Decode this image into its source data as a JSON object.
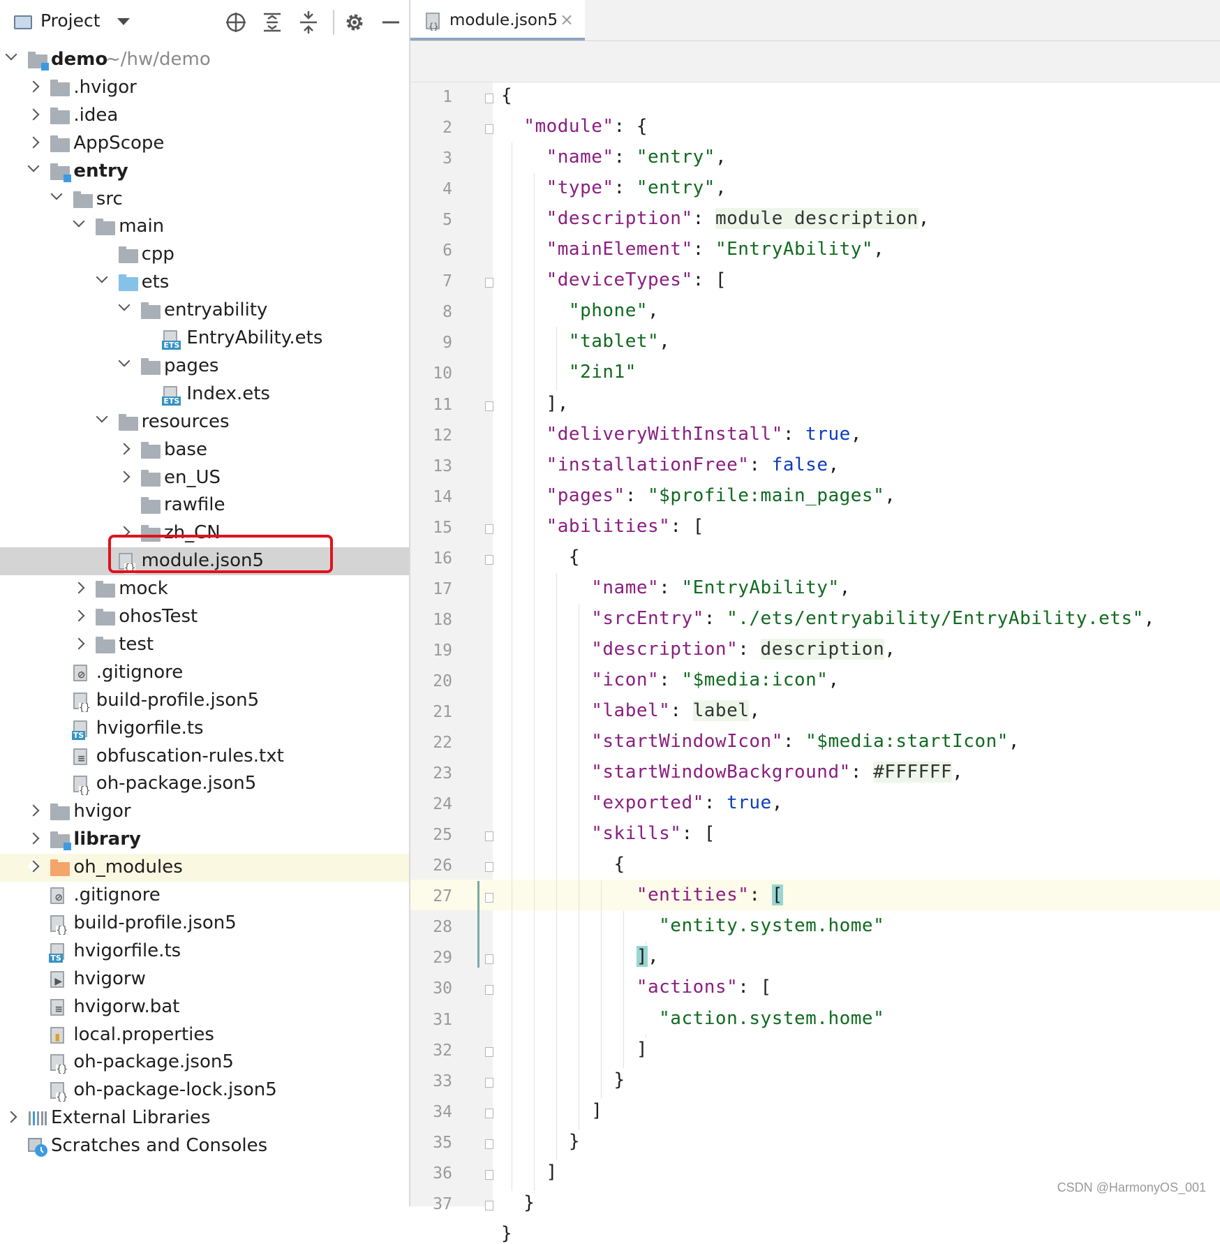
{
  "project_panel": {
    "title": "Project",
    "toolbar_icons": [
      "locate-icon",
      "expand-all-icon",
      "collapse-all-icon",
      "gear-icon",
      "minimize-icon"
    ],
    "tree": [
      {
        "label": "demo",
        "path": "~/hw/demo",
        "depth": 0,
        "arrow": "down",
        "icon": "module-folder",
        "bold": true
      },
      {
        "label": ".hvigor",
        "depth": 1,
        "arrow": "right",
        "icon": "folder"
      },
      {
        "label": ".idea",
        "depth": 1,
        "arrow": "right",
        "icon": "folder"
      },
      {
        "label": "AppScope",
        "depth": 1,
        "arrow": "right",
        "icon": "folder"
      },
      {
        "label": "entry",
        "depth": 1,
        "arrow": "down",
        "icon": "module-folder",
        "bold": true
      },
      {
        "label": "src",
        "depth": 2,
        "arrow": "down",
        "icon": "folder"
      },
      {
        "label": "main",
        "depth": 3,
        "arrow": "down",
        "icon": "folder"
      },
      {
        "label": "cpp",
        "depth": 4,
        "arrow": "none",
        "icon": "folder"
      },
      {
        "label": "ets",
        "depth": 4,
        "arrow": "down",
        "icon": "blue-folder"
      },
      {
        "label": "entryability",
        "depth": 5,
        "arrow": "down",
        "icon": "folder"
      },
      {
        "label": "EntryAbility.ets",
        "depth": 6,
        "arrow": "none",
        "icon": "ets-file"
      },
      {
        "label": "pages",
        "depth": 5,
        "arrow": "down",
        "icon": "folder"
      },
      {
        "label": "Index.ets",
        "depth": 6,
        "arrow": "none",
        "icon": "ets-file"
      },
      {
        "label": "resources",
        "depth": 4,
        "arrow": "down",
        "icon": "folder"
      },
      {
        "label": "base",
        "depth": 5,
        "arrow": "right",
        "icon": "folder"
      },
      {
        "label": "en_US",
        "depth": 5,
        "arrow": "right",
        "icon": "folder"
      },
      {
        "label": "rawfile",
        "depth": 5,
        "arrow": "none",
        "icon": "folder"
      },
      {
        "label": "zh_CN",
        "depth": 5,
        "arrow": "right",
        "icon": "folder"
      },
      {
        "label": "module.json5",
        "depth": 4,
        "arrow": "none",
        "icon": "json-file",
        "selected": true
      },
      {
        "label": "mock",
        "depth": 3,
        "arrow": "right",
        "icon": "folder"
      },
      {
        "label": "ohosTest",
        "depth": 3,
        "arrow": "right",
        "icon": "folder"
      },
      {
        "label": "test",
        "depth": 3,
        "arrow": "right",
        "icon": "folder"
      },
      {
        "label": ".gitignore",
        "depth": 2,
        "arrow": "none",
        "icon": "ignore-file"
      },
      {
        "label": "build-profile.json5",
        "depth": 2,
        "arrow": "none",
        "icon": "json-file"
      },
      {
        "label": "hvigorfile.ts",
        "depth": 2,
        "arrow": "none",
        "icon": "ts-file"
      },
      {
        "label": "obfuscation-rules.txt",
        "depth": 2,
        "arrow": "none",
        "icon": "text-file"
      },
      {
        "label": "oh-package.json5",
        "depth": 2,
        "arrow": "none",
        "icon": "json-file"
      },
      {
        "label": "hvigor",
        "depth": 1,
        "arrow": "right",
        "icon": "folder"
      },
      {
        "label": "library",
        "depth": 1,
        "arrow": "right",
        "icon": "module-folder",
        "bold": true
      },
      {
        "label": "oh_modules",
        "depth": 1,
        "arrow": "right",
        "icon": "orange-folder",
        "highlight": true
      },
      {
        "label": ".gitignore",
        "depth": 1,
        "arrow": "none",
        "icon": "ignore-file"
      },
      {
        "label": "build-profile.json5",
        "depth": 1,
        "arrow": "none",
        "icon": "json-file"
      },
      {
        "label": "hvigorfile.ts",
        "depth": 1,
        "arrow": "none",
        "icon": "ts-file"
      },
      {
        "label": "hvigorw",
        "depth": 1,
        "arrow": "none",
        "icon": "exec-file"
      },
      {
        "label": "hvigorw.bat",
        "depth": 1,
        "arrow": "none",
        "icon": "text-file"
      },
      {
        "label": "local.properties",
        "depth": 1,
        "arrow": "none",
        "icon": "properties-file"
      },
      {
        "label": "oh-package.json5",
        "depth": 1,
        "arrow": "none",
        "icon": "json-file"
      },
      {
        "label": "oh-package-lock.json5",
        "depth": 1,
        "arrow": "none",
        "icon": "json-file"
      },
      {
        "label": "External Libraries",
        "depth": 0,
        "arrow": "right",
        "icon": "libraries-icon"
      },
      {
        "label": "Scratches and Consoles",
        "depth": 0,
        "arrow": "none",
        "icon": "scratches-icon"
      }
    ]
  },
  "editor": {
    "tab": {
      "label": "module.json5",
      "close": "×",
      "icon": "json-file-icon"
    },
    "lines": [
      [
        [
          "p",
          "{"
        ]
      ],
      [
        [
          "p",
          "  "
        ],
        [
          "k",
          "\"module\""
        ],
        [
          "p",
          ": {"
        ]
      ],
      [
        [
          "p",
          "    "
        ],
        [
          "k",
          "\"name\""
        ],
        [
          "p",
          ": "
        ],
        [
          "s",
          "\"entry\""
        ],
        [
          "p",
          ","
        ]
      ],
      [
        [
          "p",
          "    "
        ],
        [
          "k",
          "\"type\""
        ],
        [
          "p",
          ": "
        ],
        [
          "s",
          "\"entry\""
        ],
        [
          "p",
          ","
        ]
      ],
      [
        [
          "p",
          "    "
        ],
        [
          "k",
          "\"description\""
        ],
        [
          "p",
          ": "
        ],
        [
          "n",
          "module description"
        ],
        [
          "p",
          ","
        ]
      ],
      [
        [
          "p",
          "    "
        ],
        [
          "k",
          "\"mainElement\""
        ],
        [
          "p",
          ": "
        ],
        [
          "s",
          "\"EntryAbility\""
        ],
        [
          "p",
          ","
        ]
      ],
      [
        [
          "p",
          "    "
        ],
        [
          "k",
          "\"deviceTypes\""
        ],
        [
          "p",
          ": ["
        ]
      ],
      [
        [
          "p",
          "      "
        ],
        [
          "s",
          "\"phone\""
        ],
        [
          "p",
          ","
        ]
      ],
      [
        [
          "p",
          "      "
        ],
        [
          "s",
          "\"tablet\""
        ],
        [
          "p",
          ","
        ]
      ],
      [
        [
          "p",
          "      "
        ],
        [
          "s",
          "\"2in1\""
        ]
      ],
      [
        [
          "p",
          "    ],"
        ]
      ],
      [
        [
          "p",
          "    "
        ],
        [
          "k",
          "\"deliveryWithInstall\""
        ],
        [
          "p",
          ": "
        ],
        [
          "b",
          "true"
        ],
        [
          "p",
          ","
        ]
      ],
      [
        [
          "p",
          "    "
        ],
        [
          "k",
          "\"installationFree\""
        ],
        [
          "p",
          ": "
        ],
        [
          "b",
          "false"
        ],
        [
          "p",
          ","
        ]
      ],
      [
        [
          "p",
          "    "
        ],
        [
          "k",
          "\"pages\""
        ],
        [
          "p",
          ": "
        ],
        [
          "s",
          "\"$profile:main_pages\""
        ],
        [
          "p",
          ","
        ]
      ],
      [
        [
          "p",
          "    "
        ],
        [
          "k",
          "\"abilities\""
        ],
        [
          "p",
          ": ["
        ]
      ],
      [
        [
          "p",
          "      {"
        ]
      ],
      [
        [
          "p",
          "        "
        ],
        [
          "k",
          "\"name\""
        ],
        [
          "p",
          ": "
        ],
        [
          "s",
          "\"EntryAbility\""
        ],
        [
          "p",
          ","
        ]
      ],
      [
        [
          "p",
          "        "
        ],
        [
          "k",
          "\"srcEntry\""
        ],
        [
          "p",
          ": "
        ],
        [
          "s",
          "\"./ets/entryability/EntryAbility.ets\""
        ],
        [
          "p",
          ","
        ]
      ],
      [
        [
          "p",
          "        "
        ],
        [
          "k",
          "\"description\""
        ],
        [
          "p",
          ": "
        ],
        [
          "n",
          "description"
        ],
        [
          "p",
          ","
        ]
      ],
      [
        [
          "p",
          "        "
        ],
        [
          "k",
          "\"icon\""
        ],
        [
          "p",
          ": "
        ],
        [
          "s",
          "\"$media:icon\""
        ],
        [
          "p",
          ","
        ]
      ],
      [
        [
          "p",
          "        "
        ],
        [
          "k",
          "\"label\""
        ],
        [
          "p",
          ": "
        ],
        [
          "n",
          "label"
        ],
        [
          "p",
          ","
        ]
      ],
      [
        [
          "p",
          "        "
        ],
        [
          "k",
          "\"startWindowIcon\""
        ],
        [
          "p",
          ": "
        ],
        [
          "s",
          "\"$media:startIcon\""
        ],
        [
          "p",
          ","
        ]
      ],
      [
        [
          "p",
          "        "
        ],
        [
          "k",
          "\"startWindowBackground\""
        ],
        [
          "p",
          ": "
        ],
        [
          "n",
          "#FFFFFF"
        ],
        [
          "p",
          ","
        ]
      ],
      [
        [
          "p",
          "        "
        ],
        [
          "k",
          "\"exported\""
        ],
        [
          "p",
          ": "
        ],
        [
          "b",
          "true"
        ],
        [
          "p",
          ","
        ]
      ],
      [
        [
          "p",
          "        "
        ],
        [
          "k",
          "\"skills\""
        ],
        [
          "p",
          ": ["
        ]
      ],
      [
        [
          "p",
          "          {"
        ]
      ],
      [
        [
          "p",
          "            "
        ],
        [
          "k",
          "\"entities\""
        ],
        [
          "p",
          ": "
        ],
        [
          "h",
          "["
        ]
      ],
      [
        [
          "p",
          "              "
        ],
        [
          "s",
          "\"entity.system.home\""
        ]
      ],
      [
        [
          "p",
          "            "
        ],
        [
          "h",
          "]"
        ],
        [
          "p",
          ","
        ]
      ],
      [
        [
          "p",
          "            "
        ],
        [
          "k",
          "\"actions\""
        ],
        [
          "p",
          ": ["
        ]
      ],
      [
        [
          "p",
          "              "
        ],
        [
          "s",
          "\"action.system.home\""
        ]
      ],
      [
        [
          "p",
          "            ]"
        ]
      ],
      [
        [
          "p",
          "          }"
        ]
      ],
      [
        [
          "p",
          "        ]"
        ]
      ],
      [
        [
          "p",
          "      }"
        ]
      ],
      [
        [
          "p",
          "    ]"
        ]
      ],
      [
        [
          "p",
          "  }"
        ]
      ]
    ],
    "fold_lines": [
      1,
      2,
      7,
      11,
      15,
      16,
      25,
      26,
      27,
      29,
      30,
      32,
      33,
      34,
      35,
      36,
      37
    ]
  },
  "watermark": "CSDN @HarmonyOS_001"
}
